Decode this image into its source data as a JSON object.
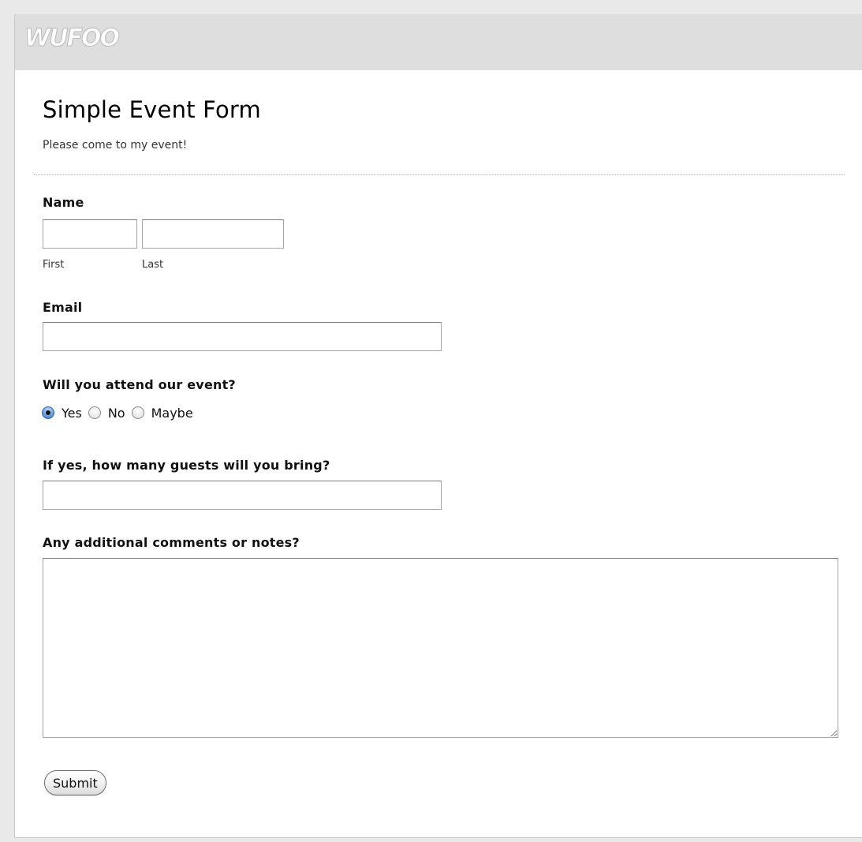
{
  "header": {
    "logo_text": "WUFOO"
  },
  "form": {
    "title": "Simple Event Form",
    "description": "Please come to my event!",
    "fields": {
      "name": {
        "label": "Name",
        "first_sublabel": "First",
        "last_sublabel": "Last",
        "first_value": "",
        "last_value": ""
      },
      "email": {
        "label": "Email",
        "value": ""
      },
      "attend": {
        "label": "Will you attend our event?",
        "options": [
          "Yes",
          "No",
          "Maybe"
        ],
        "selected": "Yes"
      },
      "guests": {
        "label": "If yes, how many guests will you bring?",
        "value": ""
      },
      "comments": {
        "label": "Any additional comments or notes?",
        "value": ""
      }
    },
    "submit_label": "Submit"
  },
  "colors": {
    "header_bar": "#dedede",
    "page_bg": "#e9e9e9",
    "radio_selected": "#2f6fc9"
  }
}
